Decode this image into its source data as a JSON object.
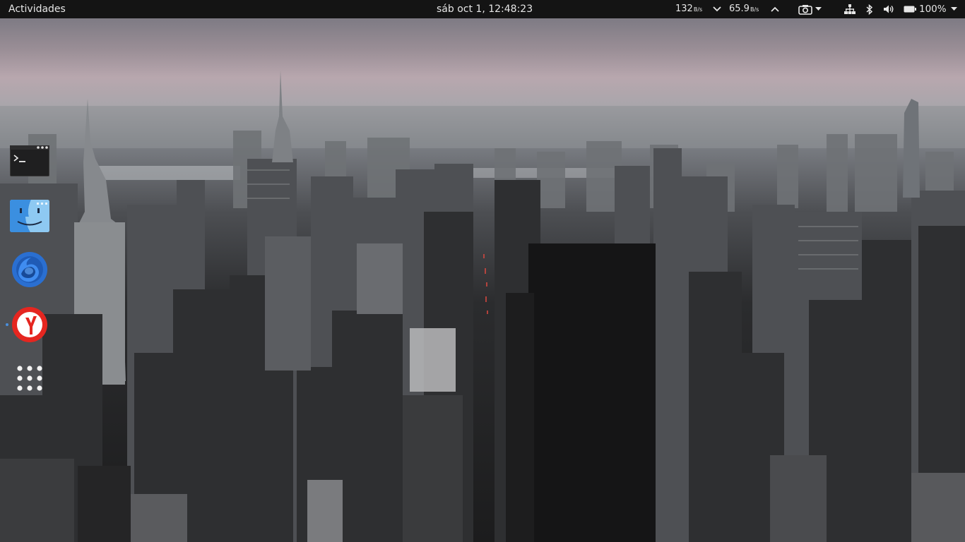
{
  "topbar": {
    "activities_label": "Actividades",
    "clock": "sáb oct  1, 12:48:23",
    "net_down_value": "132",
    "net_down_unit": "B/s",
    "net_up_value": "65.9",
    "net_up_unit": "B/s",
    "battery_percent": "100%"
  },
  "dock": {
    "items": [
      {
        "name": "Terminal",
        "icon": "terminal-icon",
        "running": false
      },
      {
        "name": "Files",
        "icon": "finder-icon",
        "running": false
      },
      {
        "name": "Firefox",
        "icon": "firefox-icon",
        "running": false
      },
      {
        "name": "Yandex Browser",
        "icon": "yandex-icon",
        "running": true
      },
      {
        "name": "Show Applications",
        "icon": "app-grid-icon",
        "running": false
      }
    ]
  },
  "colors": {
    "topbar_bg": "#141414",
    "running_indicator": "#4a8fdc",
    "yandex_red": "#e52620",
    "firefox_blue": "#2a6fd1",
    "finder_blue": "#3b8fe0"
  }
}
